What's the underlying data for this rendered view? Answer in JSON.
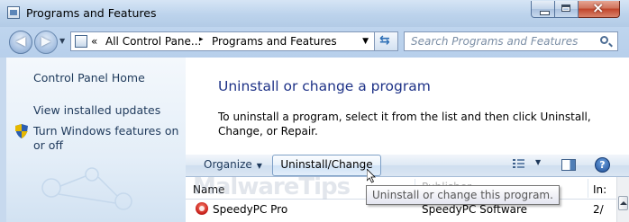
{
  "window": {
    "title": "Programs and Features"
  },
  "address_bar": {
    "overflow_glyph": "«",
    "segments": [
      "All Control Pane...",
      "Programs and Features"
    ],
    "separator": "▸"
  },
  "search": {
    "placeholder": "Search Programs and Features"
  },
  "left_pane": {
    "links": [
      "Control Panel Home",
      "View installed updates",
      "Turn Windows features on or off"
    ]
  },
  "main": {
    "title": "Uninstall or change a program",
    "description": "To uninstall a program, select it from the list and then click Uninstall, Change, or Repair."
  },
  "toolbar": {
    "organize_label": "Organize",
    "uninstall_change_label": "Uninstall/Change",
    "help_glyph": "?"
  },
  "list": {
    "columns": [
      "Name",
      "Publisher",
      "In:"
    ],
    "rows": [
      {
        "name": "SpeedyPC Pro",
        "publisher": "SpeedyPC Software",
        "installed": "2/"
      }
    ]
  },
  "tooltip": {
    "text": "Uninstall or change this program."
  },
  "watermark": {
    "text": "MalwareTips"
  },
  "colors": {
    "title_blue": "#1e3287",
    "link_blue": "#1e395b",
    "chrome_blue": "#bcd3ec"
  }
}
